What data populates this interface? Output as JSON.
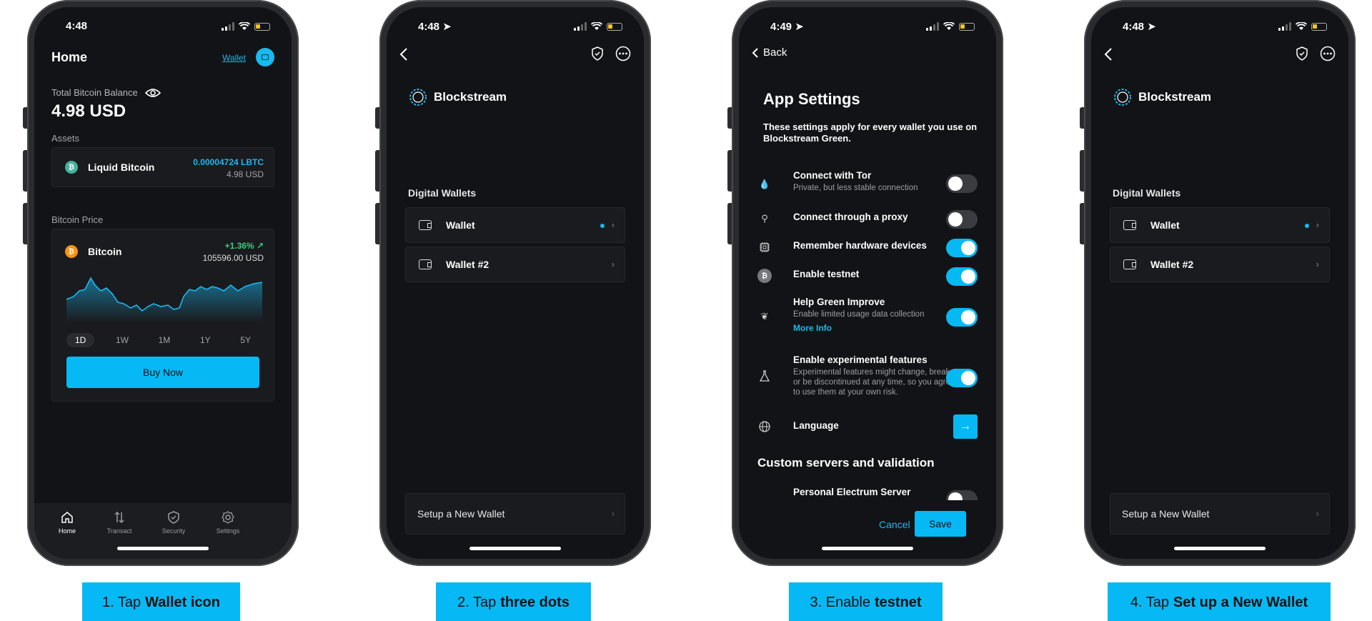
{
  "status": {
    "p1_time": "4:48",
    "p2_time": "4:48",
    "p3_time": "4:49",
    "p4_time": "4:48"
  },
  "screen1": {
    "title": "Home",
    "wallet_link": "Wallet",
    "balance_label": "Total Bitcoin Balance",
    "balance_value": "4.98 USD",
    "assets_label": "Assets",
    "asset": {
      "name": "Liquid Bitcoin",
      "amount": "0.00004724 LBTC",
      "fiat": "4.98 USD",
      "icon": "liquid-bitcoin-icon"
    },
    "price_label": "Bitcoin Price",
    "price": {
      "name": "Bitcoin",
      "change": "+1.36%",
      "value": "105596.00 USD"
    },
    "ranges": [
      "1D",
      "1W",
      "1M",
      "1Y",
      "5Y"
    ],
    "active_range": "1D",
    "buy_label": "Buy Now",
    "tabs": [
      {
        "label": "Home",
        "icon": "home-icon"
      },
      {
        "label": "Transact",
        "icon": "transact-icon"
      },
      {
        "label": "Security",
        "icon": "shield-icon"
      },
      {
        "label": "Settings",
        "icon": "gear-icon"
      }
    ],
    "accent": "#06b9f5"
  },
  "screen2": {
    "brand": "Blockstream",
    "section": "Digital Wallets",
    "wallets": [
      "Wallet",
      "Wallet #2"
    ],
    "setup": "Setup a New Wallet"
  },
  "screen3": {
    "back": "Back",
    "title": "App Settings",
    "description": "These settings apply for every wallet you use on Blockstream Green.",
    "settings": [
      {
        "title": "Connect with Tor",
        "subtitle": "Private, but less stable connection",
        "on": false,
        "icon": "tor-icon"
      },
      {
        "title": "Connect through a proxy",
        "subtitle": "",
        "on": false,
        "icon": "proxy-icon"
      },
      {
        "title": "Remember hardware devices",
        "subtitle": "",
        "on": true,
        "icon": "chip-icon"
      },
      {
        "title": "Enable testnet",
        "subtitle": "",
        "on": true,
        "icon": "testnet-icon"
      },
      {
        "title": "Help Green Improve",
        "subtitle": "Enable limited usage data collection",
        "on": true,
        "icon": "improve-icon"
      },
      {
        "title": "Enable experimental features",
        "subtitle": "Experimental features might change, break, or be discontinued at any time, so you agree to use them at your own risk.",
        "on": true,
        "icon": "flask-icon"
      }
    ],
    "more_info": "More Info",
    "language": "Language",
    "section": "Custom servers and validation",
    "partial_item": "Personal Electrum Server",
    "cancel": "Cancel",
    "save": "Save"
  },
  "screen4": {
    "brand": "Blockstream",
    "section": "Digital Wallets",
    "wallets": [
      "Wallet",
      "Wallet #2"
    ],
    "setup": "Setup a New Wallet"
  },
  "captions": [
    {
      "prefix": "1. Tap",
      "bold": "Wallet icon"
    },
    {
      "prefix": "2. Tap",
      "bold": "three dots"
    },
    {
      "prefix": "3. Enable",
      "bold": "testnet"
    },
    {
      "prefix": "4. Tap",
      "bold": "Set up a New Wallet"
    }
  ]
}
